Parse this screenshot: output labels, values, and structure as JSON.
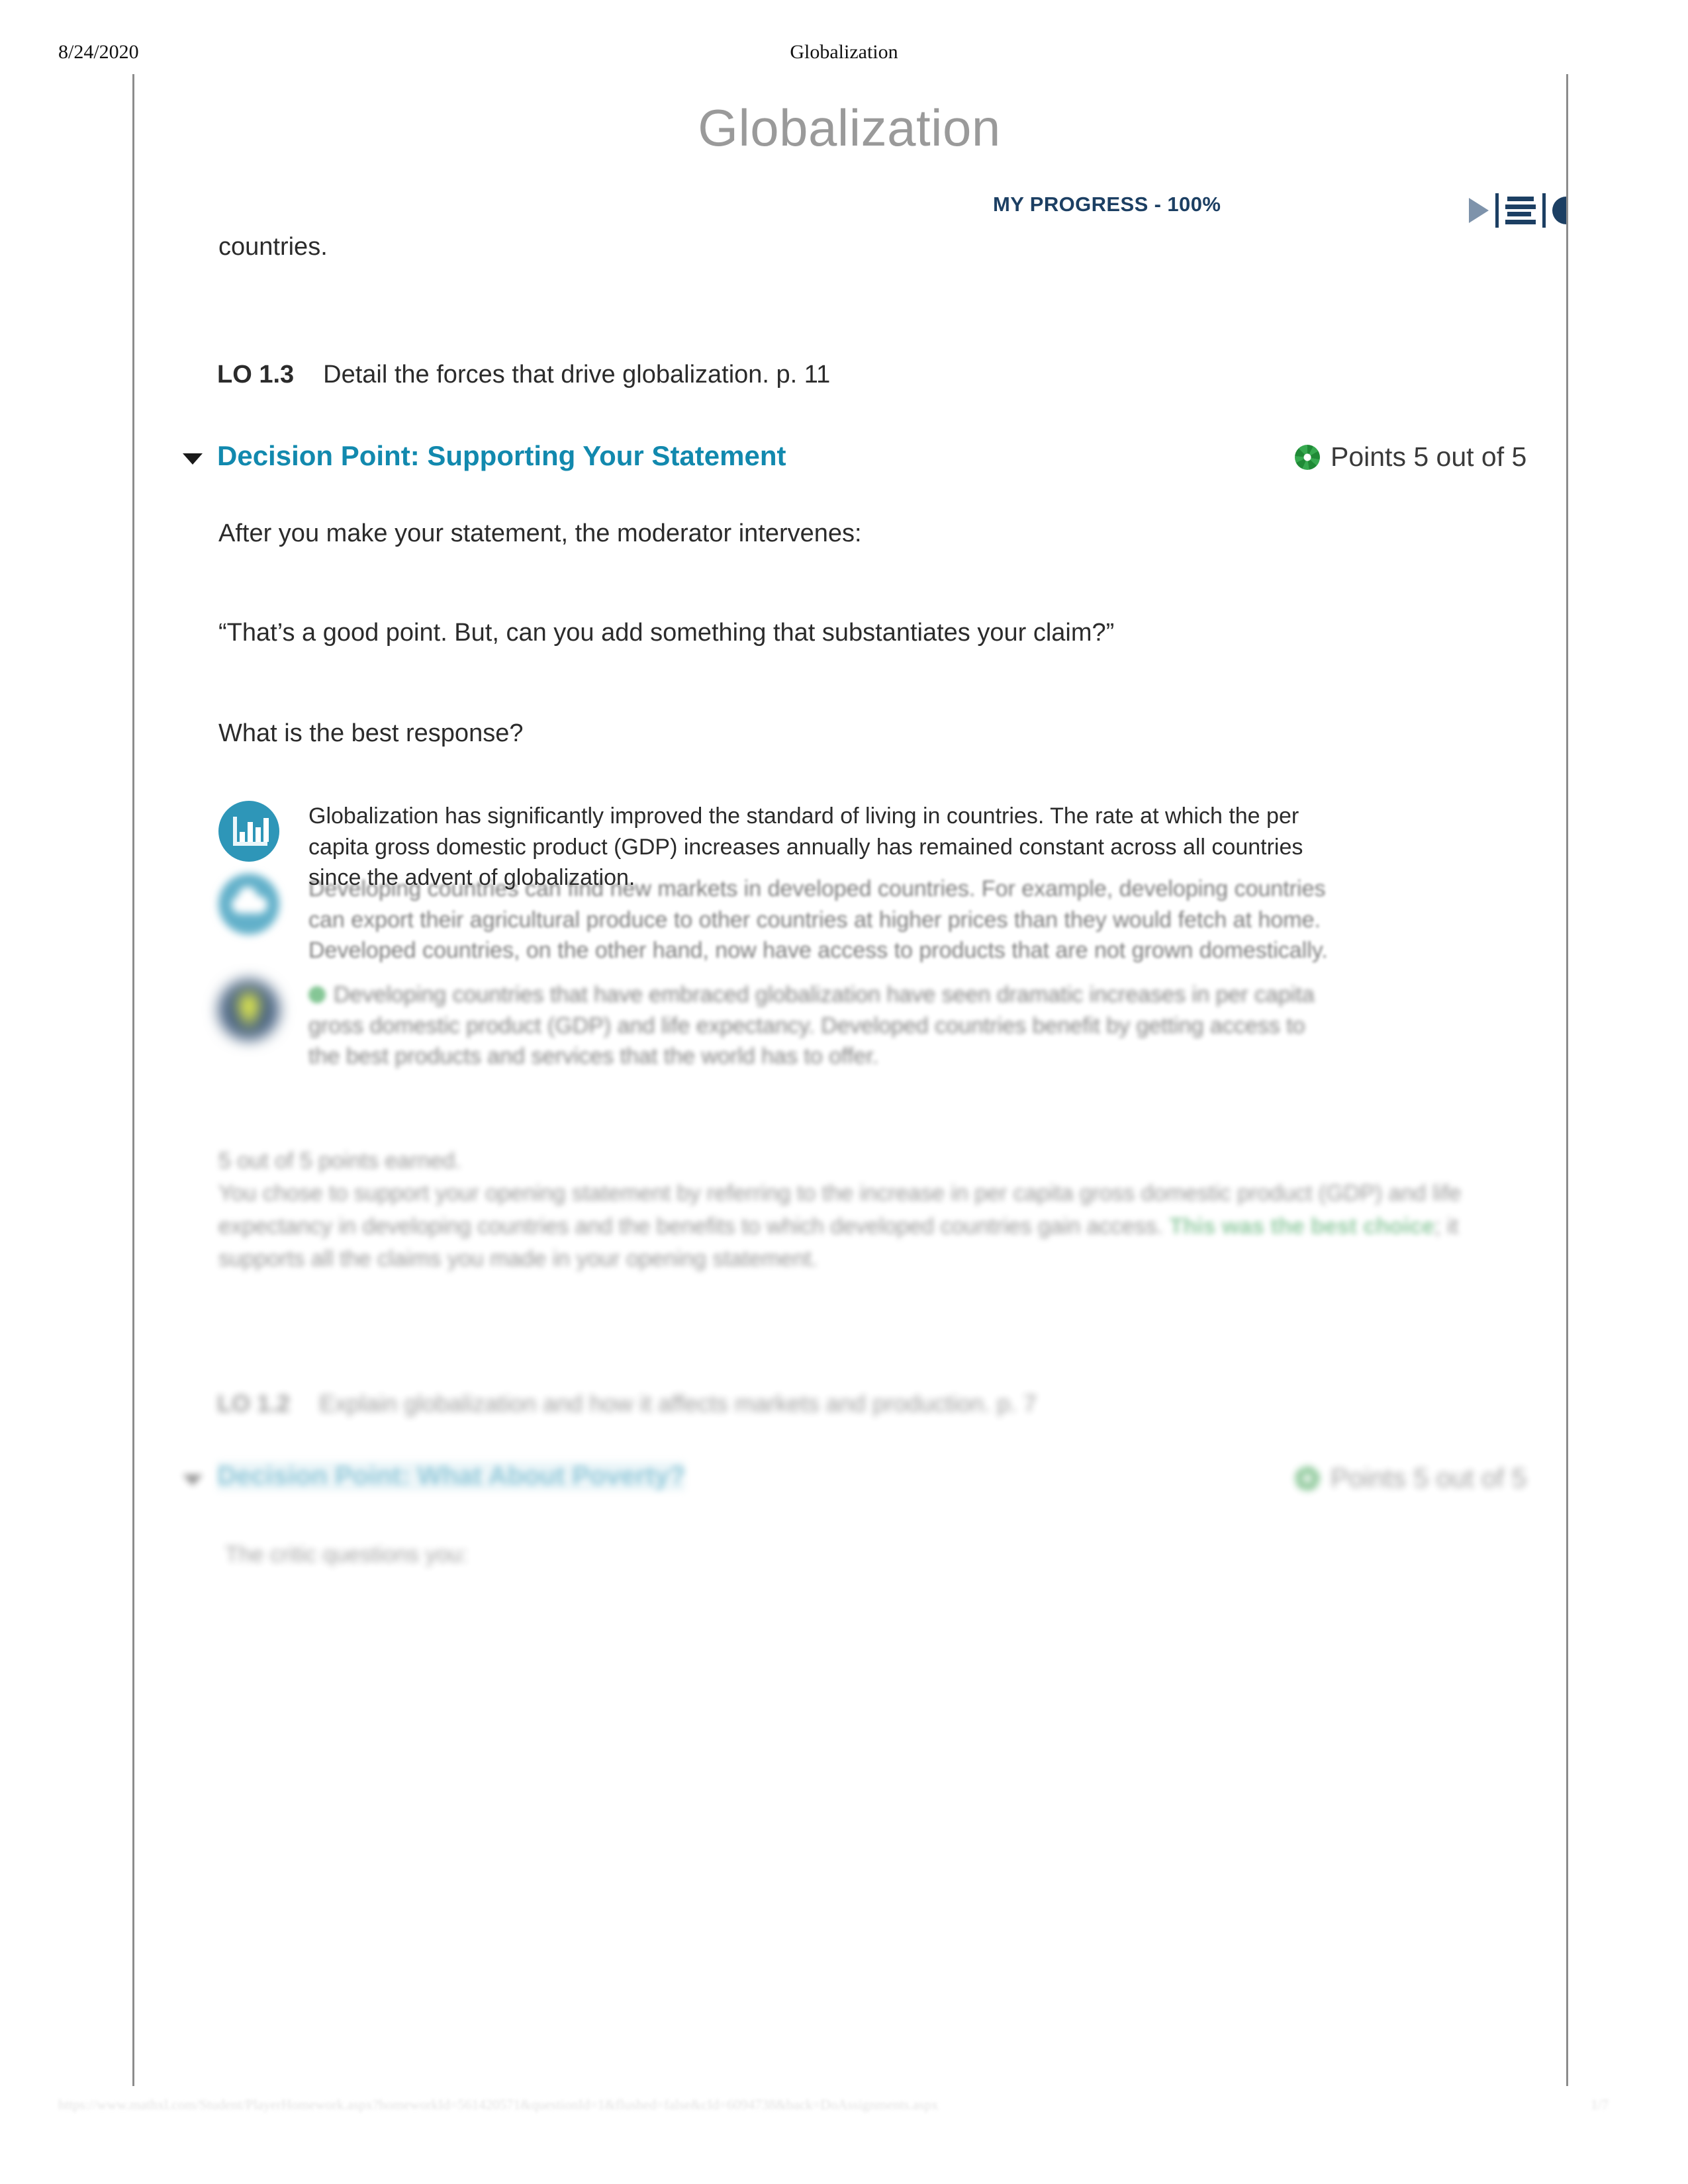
{
  "print": {
    "date": "8/24/2020",
    "header_title": "Globalization",
    "footer_url": "https://www.mathxl.com/Student/PlayerHomework.aspx?homeworkId=561420571&questionId=1&flushed=false&cId=6094738&back=DoAssignments.aspx",
    "footer_page": "1/7"
  },
  "header": {
    "course_title": "Globalization",
    "progress_label": "MY PROGRESS - 100%",
    "toolbar": {
      "play": "play-icon",
      "list": "list-view-icon",
      "contrast": "contrast-icon"
    }
  },
  "top_fragment": {
    "text": "countries."
  },
  "learning_objective_1": {
    "code": "LO 1.3",
    "text": "Detail the forces that drive globalization. p. 11"
  },
  "decision_point_1": {
    "title": "Decision Point: Supporting Your Statement",
    "points_label": "Points 5 out of 5",
    "badge_color": "#2e9e4a",
    "accent_color": "#1289ae",
    "prompt_intro": "After you make your statement, the moderator intervenes:",
    "quote": "“That’s a good point. But, can you add something that substantiates your claim?”",
    "question": "What is the best response?",
    "options": [
      {
        "icon": "bar-chart-icon",
        "icon_bg": "#2e96b8",
        "text": "Globalization has significantly improved the standard of living in countries. The rate at which the per capita gross domestic product (GDP) increases annually has remained constant across all countries since the advent of globalization.",
        "selected": false
      },
      {
        "icon": "cloud-icon",
        "icon_bg": "#2e96b8",
        "text": "Developing countries can find new markets in developed countries. For example, developing countries can export their agricultural produce to other countries at higher prices than they would fetch at home. Developed countries, on the other hand, now have access to products that are not grown domestically.",
        "selected": false
      },
      {
        "icon": "lightbulb-icon",
        "icon_bg": "#1b3c63",
        "text": "Developing countries that have embraced globalization have seen dramatic increases in per capita gross domestic product (GDP) and life expectancy. Developed countries benefit by getting access to the best products and services that the world has to offer.",
        "selected": true
      }
    ],
    "feedback": {
      "score_line": "5 out of 5 points earned.",
      "body_before": "You chose to support your opening statement by referring to the increase in per capita gross domestic product (GDP) and life expectancy in developing countries and the benefits to which developed countries gain access. ",
      "highlight": "This was the best choice",
      "body_after": "; it supports all the claims you made in your opening statement.",
      "highlight_color": "#2f9b4e"
    }
  },
  "learning_objective_2": {
    "code": "LO 1.2",
    "text": "Explain globalization and how it affects markets and production. p. 7"
  },
  "decision_point_2": {
    "title": "Decision Point: What About Poverty?",
    "points_label": "Points 5 out of 5",
    "tail_text": "The critic questions you:"
  }
}
